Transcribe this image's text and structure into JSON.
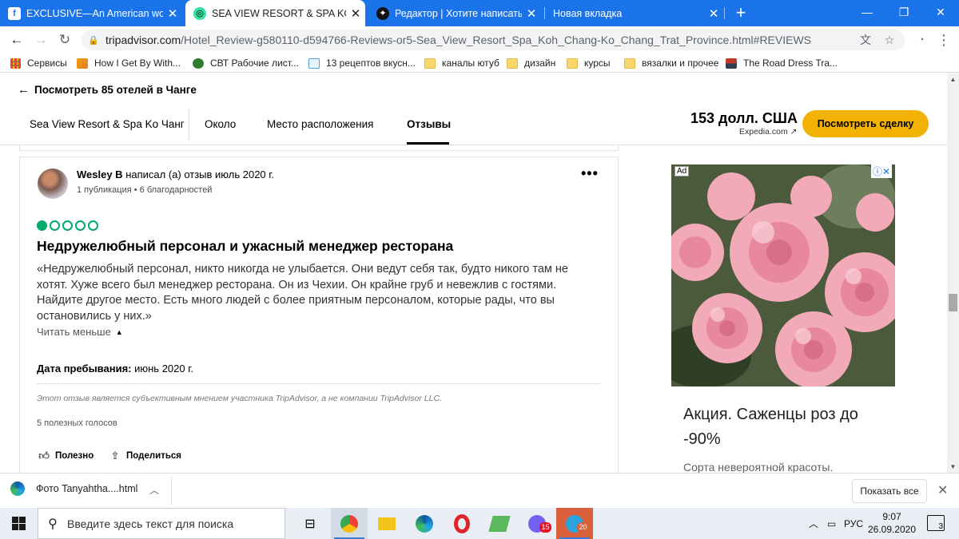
{
  "browser": {
    "tabs": [
      {
        "title": "EXCLUSIVE—An American workin",
        "favicon": "facebook-icon"
      },
      {
        "title": "SEA VIEW RESORT & SPA KOH CH",
        "favicon": "tripadvisor-icon",
        "active": true
      },
      {
        "title": "Редактор | Хотите написать пло",
        "favicon": "editor-icon"
      },
      {
        "title": "Новая вкладка",
        "favicon": "none"
      }
    ],
    "url_host": "tripadvisor.com",
    "url_path": "/Hotel_Review-g580110-d594766-Reviews-or5-Sea_View_Resort_Spa_Koh_Chang-Ko_Chang_Trat_Province.html#REVIEWS",
    "bookmarks": [
      {
        "label": "Сервисы",
        "icon": "apps-grid-icon"
      },
      {
        "label": "How I Get By With...",
        "icon": "bookmark-site-icon"
      },
      {
        "label": "СВТ Рабочие лист...",
        "icon": "gear-site-icon"
      },
      {
        "label": "13 рецептов вкусн...",
        "icon": "recipe-site-icon"
      },
      {
        "label": "каналы ютуб",
        "icon": "folder-icon"
      },
      {
        "label": "дизайн",
        "icon": "folder-icon"
      },
      {
        "label": "курсы",
        "icon": "folder-icon"
      },
      {
        "label": "вязалки и прочее",
        "icon": "folder-icon"
      },
      {
        "label": "The Road Dress Tra...",
        "icon": "flag-site-icon"
      }
    ]
  },
  "page": {
    "back_link": "Посмотреть 85 отелей в Чанге",
    "hotel_name": "Sea View Resort & Spa Ko Чанг",
    "nav_tabs": [
      "Около",
      "Место расположения",
      "Отзывы"
    ],
    "active_tab": "Отзывы",
    "price": "153 долл. США",
    "price_source": "Expedia.com ↗",
    "deal_button": "Посмотреть сделку",
    "accent_color": "#f2b203"
  },
  "review": {
    "author": "Wesley B",
    "author_suffix": " написал (а) отзыв июль 2020 г.",
    "meta": "1 публикация • 6 благодарностей",
    "rating": 1,
    "rating_max": 5,
    "rating_color": "#00aa6c",
    "title": "Недружелюбный персонал и ужасный менеджер ресторана",
    "body": "«Недружелюбный персонал, никто никогда не улыбается. Они ведут себя так, будто никого там не хотят. Хуже всего был менеджер ресторана. Он из Чехии. Он крайне груб и невежлив с гостями. Найдите другое место. Есть много людей с более приятным персоналом, которые рады, что вы остановились у них.»",
    "read_less": "Читать меньше",
    "stay_label": "Дата пребывания:",
    "stay_value": " июнь 2020 г.",
    "disclaimer": "Этот отзыв является субъективным мнением участника TripAdvisor, а не компании TripAdvisor LLC.",
    "votes": "5 полезных голосов",
    "helpful": "Полезно",
    "share": "Поделиться"
  },
  "ad": {
    "label": "Ad",
    "headline": "Акция. Саженцы роз до -90%",
    "subline": "Сорта невероятной красоты."
  },
  "downloads": {
    "file": "Фото Tanyahtha....html",
    "show_all": "Показать все"
  },
  "taskbar": {
    "search_placeholder": "Введите здесь текст для поиска",
    "viber_badge": "15",
    "telegram_badge": "20",
    "language": "РУС",
    "time": "9:07",
    "date": "26.09.2020",
    "notifications": "3"
  }
}
